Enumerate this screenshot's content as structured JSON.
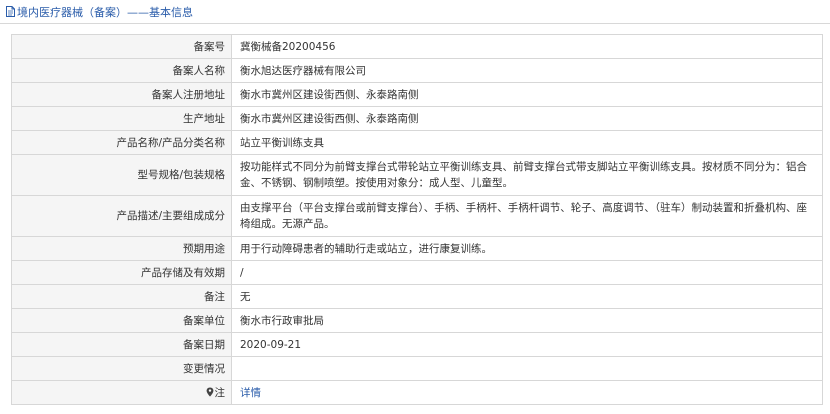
{
  "header": {
    "title": "境内医疗器械（备案）——基本信息"
  },
  "rows": [
    {
      "label": "备案号",
      "value": "冀衡械备20200456"
    },
    {
      "label": "备案人名称",
      "value": "衡水旭达医疗器械有限公司"
    },
    {
      "label": "备案人注册地址",
      "value": "衡水市冀州区建设街西侧、永泰路南侧"
    },
    {
      "label": "生产地址",
      "value": "衡水市冀州区建设街西侧、永泰路南侧"
    },
    {
      "label": "产品名称/产品分类名称",
      "value": "站立平衡训练支具"
    },
    {
      "label": "型号规格/包装规格",
      "value": "按功能样式不同分为前臂支撑台式带轮站立平衡训练支具、前臂支撑台式带支脚站立平衡训练支具。按材质不同分为：铝合金、不锈钢、钢制喷塑。按使用对象分：成人型、儿童型。"
    },
    {
      "label": "产品描述/主要组成成分",
      "value": "由支撑平台（平台支撑台或前臂支撑台）、手柄、手柄杆、手柄杆调节、轮子、高度调节、（驻车）制动装置和折叠机构、座椅组成。无源产品。"
    },
    {
      "label": "预期用途",
      "value": "用于行动障碍患者的辅助行走或站立，进行康复训练。"
    },
    {
      "label": "产品存储及有效期",
      "value": "/"
    },
    {
      "label": "备注",
      "value": "无"
    },
    {
      "label": "备案单位",
      "value": "衡水市行政审批局"
    },
    {
      "label": "备案日期",
      "value": "2020-09-21"
    },
    {
      "label": "变更情况",
      "value": ""
    }
  ],
  "note_row": {
    "label": "注",
    "link": "详情"
  }
}
